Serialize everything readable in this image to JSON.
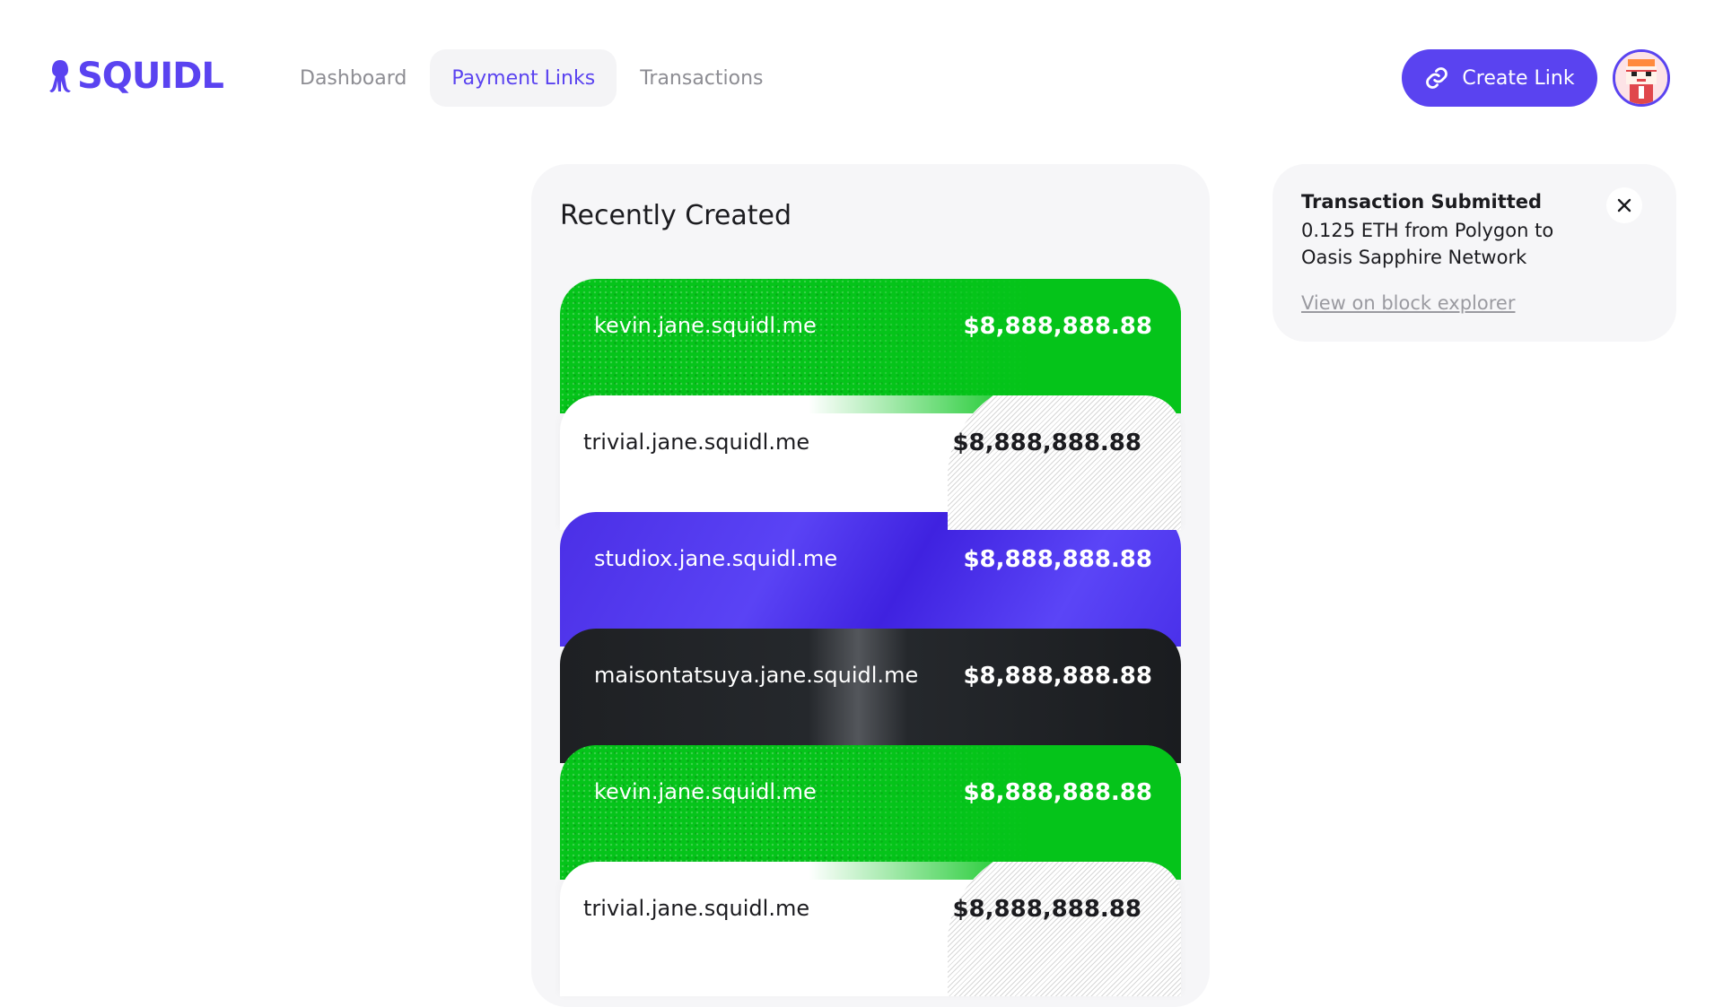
{
  "app": {
    "logo_text": "SQUIDL",
    "brand_color": "#5a43f0"
  },
  "nav": {
    "items": [
      {
        "label": "Dashboard",
        "active": false
      },
      {
        "label": "Payment Links",
        "active": true
      },
      {
        "label": "Transactions",
        "active": false
      }
    ]
  },
  "header": {
    "create_label": "Create Link",
    "create_icon": "link-icon"
  },
  "recent": {
    "title": "Recently Created",
    "links": [
      {
        "url": "kevin.jane.squidl.me",
        "amount": "$8,888,888.88",
        "theme": "green"
      },
      {
        "url": "trivial.jane.squidl.me",
        "amount": "$8,888,888.88",
        "theme": "white"
      },
      {
        "url": "studiox.jane.squidl.me",
        "amount": "$8,888,888.88",
        "theme": "purple"
      },
      {
        "url": "maisontatsuya.jane.squidl.me",
        "amount": "$8,888,888.88",
        "theme": "black"
      },
      {
        "url": "kevin.jane.squidl.me",
        "amount": "$8,888,888.88",
        "theme": "green"
      },
      {
        "url": "trivial.jane.squidl.me",
        "amount": "$8,888,888.88",
        "theme": "white"
      }
    ]
  },
  "toast": {
    "title": "Transaction Submitted",
    "message": "0.125 ETH from Polygon to Oasis Sapphire Network",
    "link": "View on block explorer",
    "close_icon": "close-icon"
  },
  "colors": {
    "green": "#05c41a",
    "purple": "#4b2fe6",
    "black": "#1e2023"
  }
}
